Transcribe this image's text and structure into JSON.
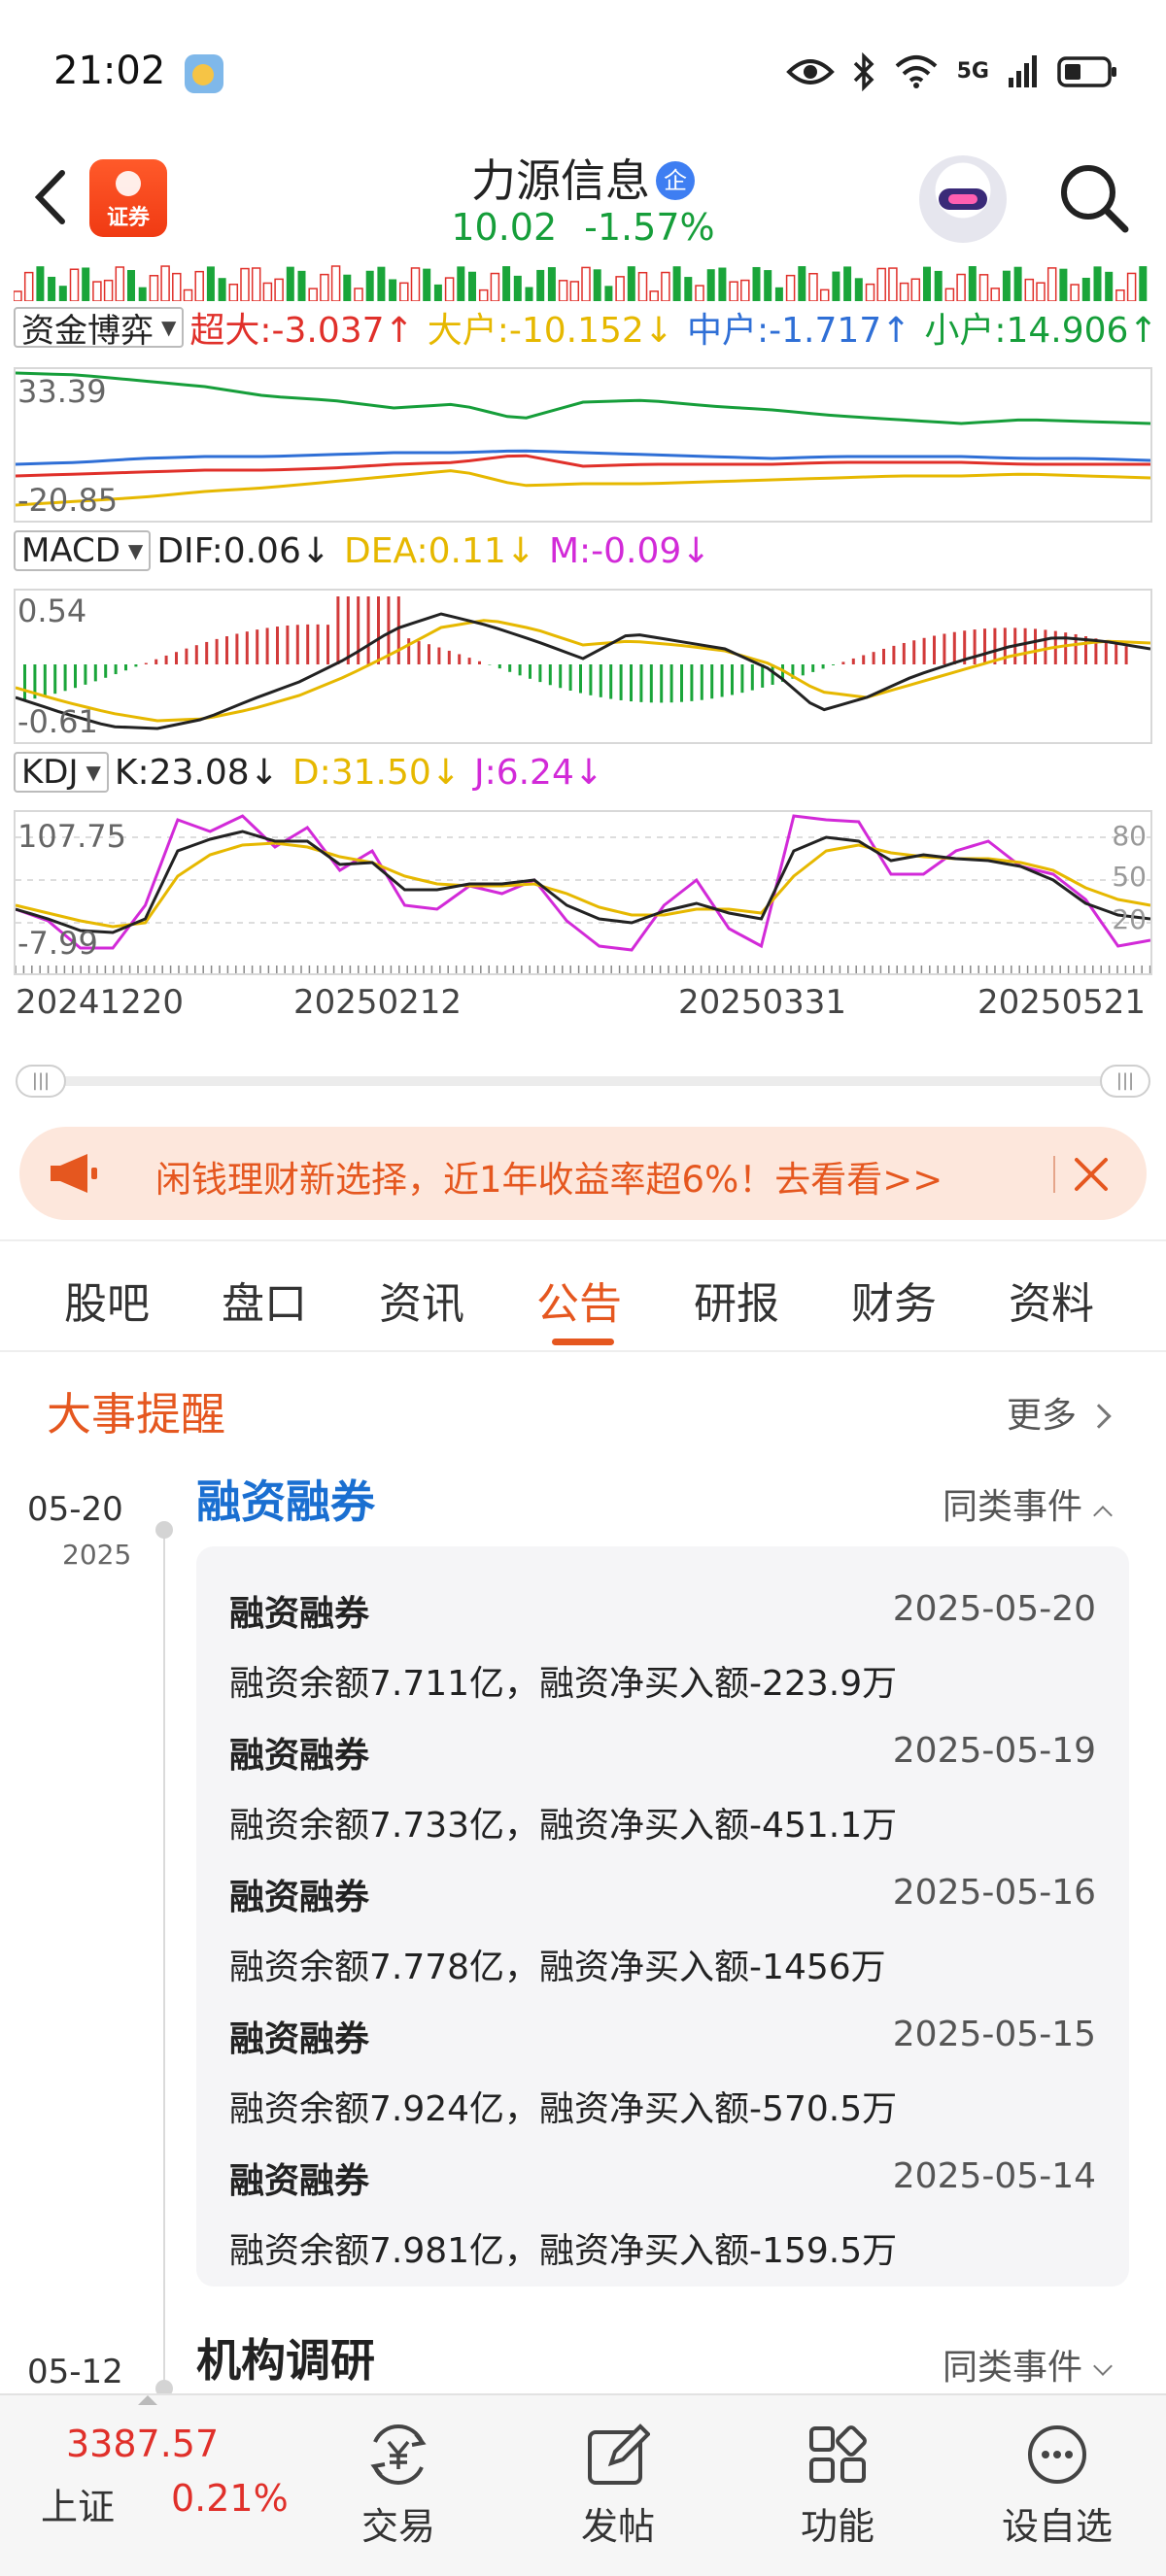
{
  "status_bar": {
    "time": "21:02",
    "network": "5G"
  },
  "header": {
    "logo_text": "证券",
    "stock_name": "力源信息",
    "badge": "企",
    "price": "10.02",
    "change_pct": "-1.57%"
  },
  "indicators": {
    "fund": {
      "selector": "资金博弈",
      "items": [
        "超大:-3.037↑",
        "大户:-10.152↓",
        "中户:-1.717↑",
        "小户:14.906↑"
      ],
      "colors": [
        "#e0302a",
        "#e6b800",
        "#2f6fd6",
        "#169e3a"
      ],
      "ymax": "33.39",
      "ymin": "-20.85"
    },
    "macd": {
      "selector": "MACD",
      "items": [
        "DIF:0.06↓",
        "DEA:0.11↓",
        "M:-0.09↓"
      ],
      "colors": [
        "#222222",
        "#e6b800",
        "#d22ad8"
      ],
      "ymax": "0.54",
      "ymin": "-0.61"
    },
    "kdj": {
      "selector": "KDJ",
      "items": [
        "K:23.08↓",
        "D:31.50↓",
        "J:6.24↓"
      ],
      "colors": [
        "#222222",
        "#e6b800",
        "#d22ad8"
      ],
      "ymax": "107.75",
      "ymin": "-7.99",
      "right_levels": [
        "80",
        "50",
        "20"
      ]
    }
  },
  "dates": [
    "20241220",
    "20250212",
    "20250331",
    "20250521"
  ],
  "scroll_handle_glyph": "|||",
  "banner": {
    "text": "闲钱理财新选择，近1年收益率超6%！去看看>>"
  },
  "tabs": [
    {
      "label": "股吧"
    },
    {
      "label": "盘口"
    },
    {
      "label": "资讯"
    },
    {
      "label": "公告",
      "active": true
    },
    {
      "label": "研报"
    },
    {
      "label": "财务"
    },
    {
      "label": "资料"
    }
  ],
  "events": {
    "title": "大事提醒",
    "more": "更多",
    "same_type": "同类事件",
    "groups": [
      {
        "date": "05-20",
        "year": "2025",
        "title": "融资融券",
        "items": [
          {
            "title": "融资融券",
            "date": "2025-05-20",
            "desc": "融资余额7.711亿，融资净买入额-223.9万"
          },
          {
            "title": "融资融券",
            "date": "2025-05-19",
            "desc": "融资余额7.733亿，融资净买入额-451.1万"
          },
          {
            "title": "融资融券",
            "date": "2025-05-16",
            "desc": "融资余额7.778亿，融资净买入额-1456万"
          },
          {
            "title": "融资融券",
            "date": "2025-05-15",
            "desc": "融资余额7.924亿，融资净买入额-570.5万"
          },
          {
            "title": "融资融券",
            "date": "2025-05-14",
            "desc": "融资余额7.981亿，融资净买入额-159.5万"
          }
        ]
      },
      {
        "date": "05-12",
        "title": "机构调研"
      }
    ]
  },
  "bottom_nav": {
    "index_value": "3387.57",
    "index_name": "上证",
    "index_change": "0.21%",
    "items": [
      {
        "label": "交易",
        "icon": "trade-icon"
      },
      {
        "label": "发帖",
        "icon": "edit-icon"
      },
      {
        "label": "功能",
        "icon": "apps-icon"
      },
      {
        "label": "设自选",
        "icon": "more-icon"
      }
    ]
  }
}
